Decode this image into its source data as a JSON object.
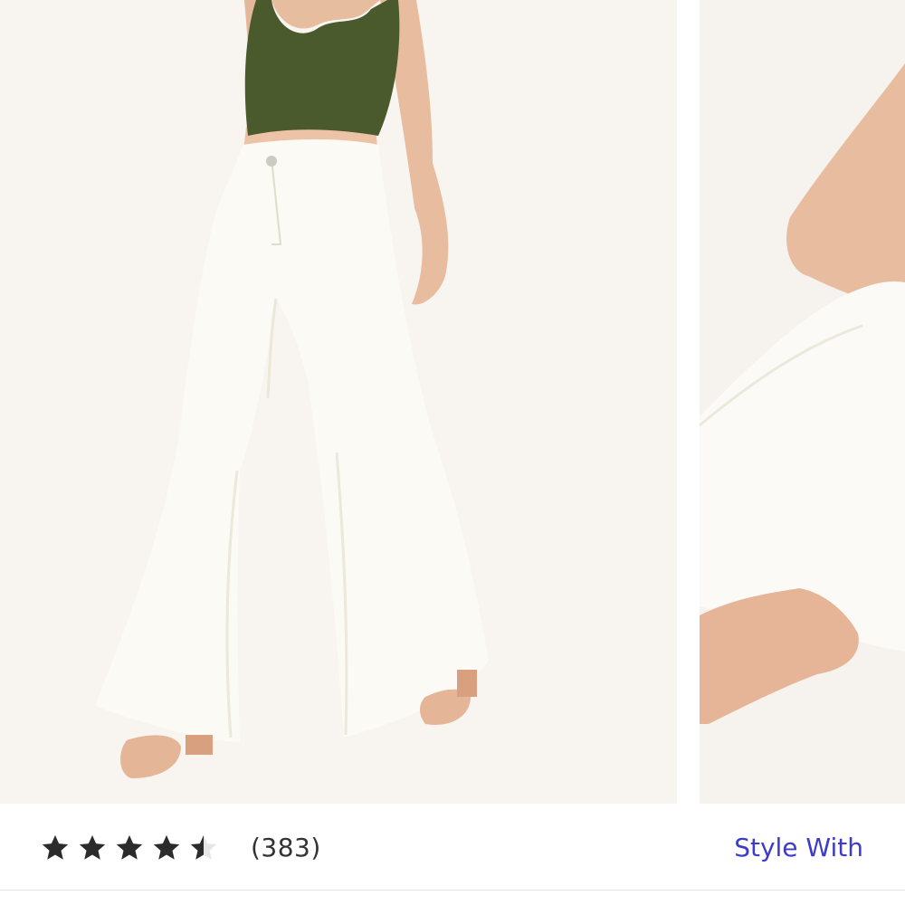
{
  "product": {
    "images": [
      {
        "name": "Model wearing white flare jeans with green crop top"
      },
      {
        "name": "Close-up of flare hem and bare foot"
      }
    ]
  },
  "rating": {
    "value": 4.5,
    "max": 5,
    "review_count": "(383)"
  },
  "actions": {
    "style_with_label": "Style With"
  },
  "colors": {
    "star": "#2b2b2b",
    "accent_link": "#3c3cc8",
    "photo_bg": "#f7f3ef"
  }
}
